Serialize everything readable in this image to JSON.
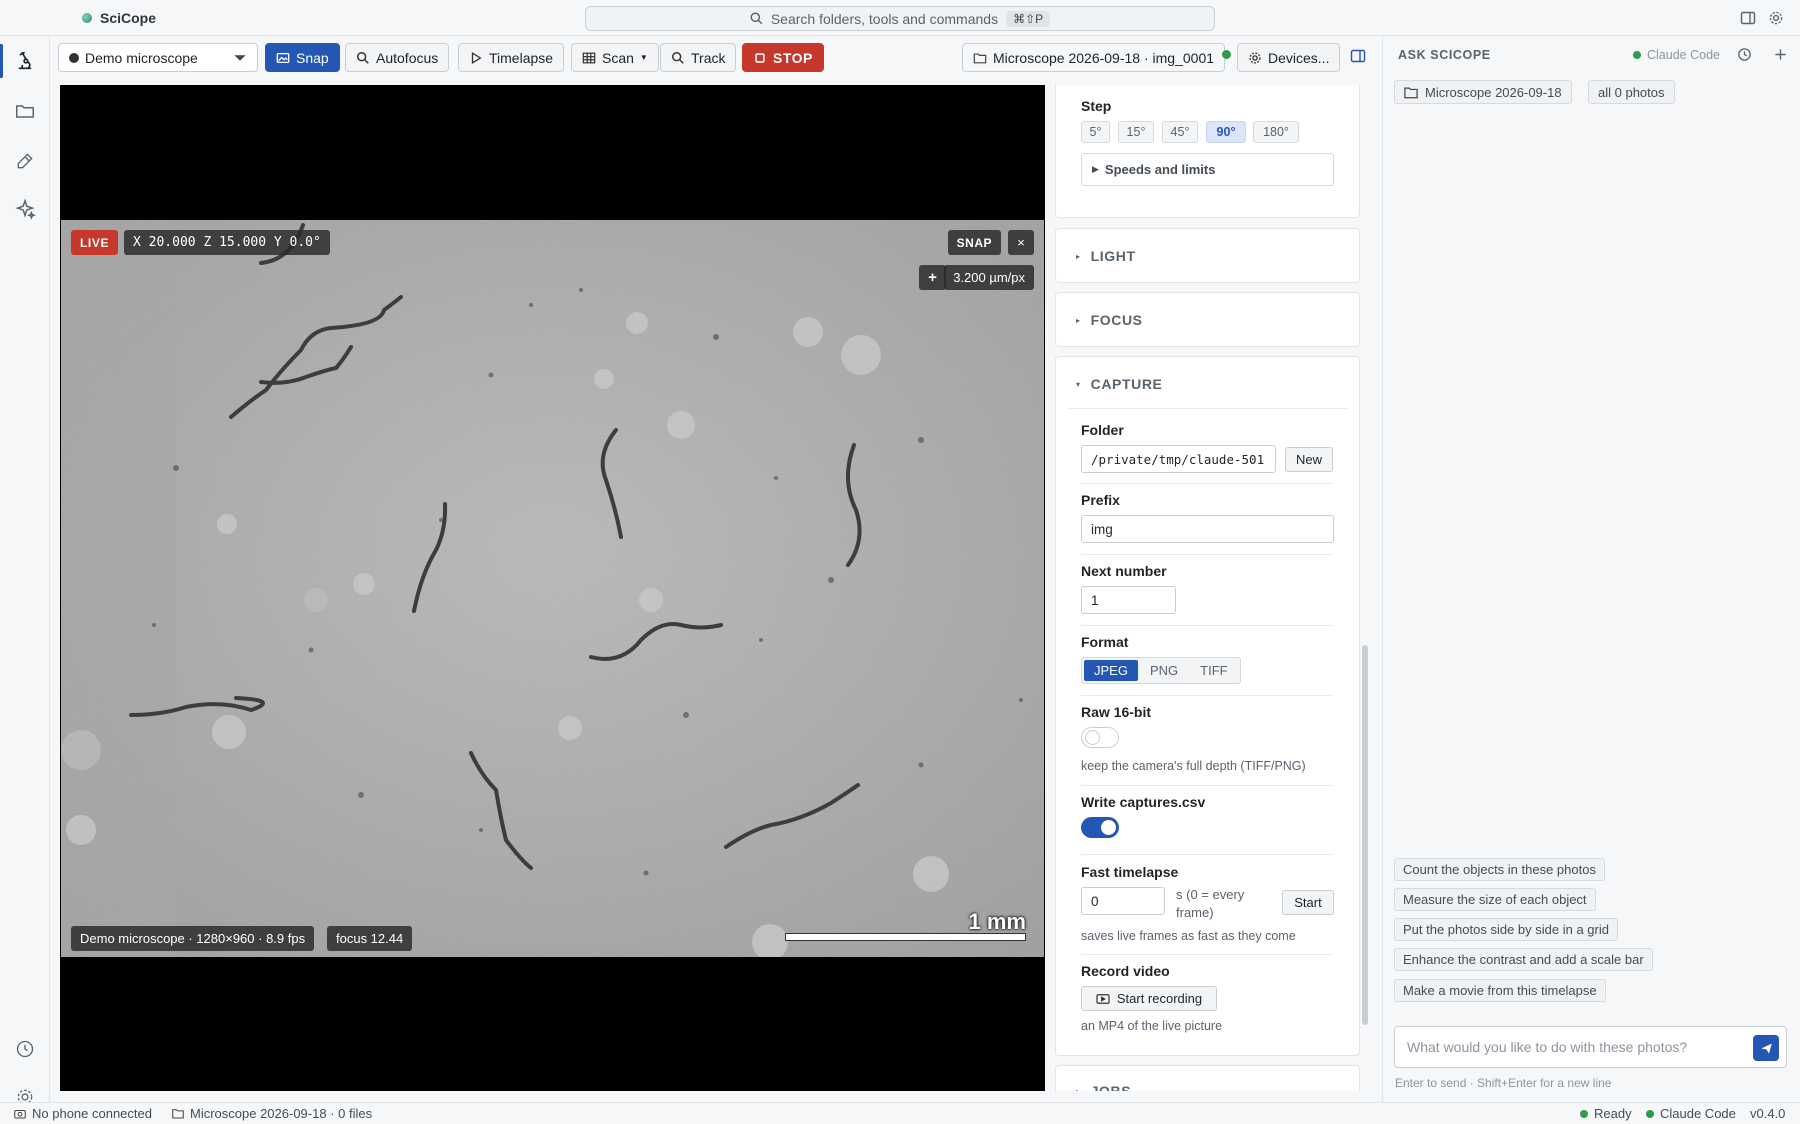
{
  "app": {
    "title": "SciCope"
  },
  "search": {
    "placeholder": "Search folders, tools and commands",
    "shortcut": "⌘⇧P"
  },
  "toolbar": {
    "device": "Demo microscope",
    "snap": "Snap",
    "autofocus": "Autofocus",
    "timelapse": "Timelapse",
    "scan": "Scan",
    "track": "Track",
    "stop": "STOP",
    "session": "Microscope 2026-09-18 · img_0001",
    "devices": "Devices..."
  },
  "viewer": {
    "live": "LIVE",
    "coords": "X 20.000 Z 15.000 Y 0.0°",
    "snap": "SNAP",
    "close": "×",
    "zoom_in": "+",
    "scale": "3.200 µm/px",
    "camera_info": "Demo microscope · 1280×960 · 8.9 fps",
    "focus": "focus 12.44",
    "scalebar_label": "1 mm"
  },
  "settings": {
    "step": {
      "label": "Step",
      "options": [
        "5°",
        "15°",
        "45°",
        "90°",
        "180°"
      ],
      "selected": "90°",
      "speeds": "Speeds and limits"
    },
    "light": {
      "title": "LIGHT"
    },
    "focus": {
      "title": "FOCUS"
    },
    "capture": {
      "title": "CAPTURE",
      "folder_label": "Folder",
      "folder_value": "/private/tmp/claude-501",
      "new_button": "New",
      "prefix_label": "Prefix",
      "prefix_value": "img",
      "next_label": "Next number",
      "next_value": "1",
      "format_label": "Format",
      "formats": [
        "JPEG",
        "PNG",
        "TIFF"
      ],
      "format_selected": "JPEG",
      "raw_label": "Raw 16-bit",
      "raw_on": false,
      "raw_hint": "keep the camera's full depth (TIFF/PNG)",
      "csv_label": "Write captures.csv",
      "csv_on": true,
      "fast_label": "Fast timelapse",
      "fast_value": "0",
      "fast_unit": "s (0 = every frame)",
      "fast_start": "Start",
      "fast_hint": "saves live frames as fast as they come",
      "record_label": "Record video",
      "record_button": "Start recording",
      "record_hint": "an MP4 of the live picture"
    },
    "jobs": {
      "title": "JOBS"
    }
  },
  "ask": {
    "title": "ASK SCICOPE",
    "model": "Claude Code",
    "context": [
      "Microscope 2026-09-18",
      "all 0 photos"
    ],
    "suggestions": [
      "Count the objects in these photos",
      "Measure the size of each object",
      "Put the photos side by side in a grid",
      "Enhance the contrast and add a scale bar",
      "Make a movie from this timelapse"
    ],
    "placeholder": "What would you like to do with these photos?",
    "hint": "Enter to send · Shift+Enter for a new line"
  },
  "statusbar": {
    "phone": "No phone connected",
    "folder": "Microscope 2026-09-18 · 0 files",
    "ready": "Ready",
    "model": "Claude Code",
    "version": "v0.4.0"
  },
  "colors": {
    "accent": "#2456b3",
    "stop": "#c5382b",
    "ok": "#2a9d4b"
  }
}
